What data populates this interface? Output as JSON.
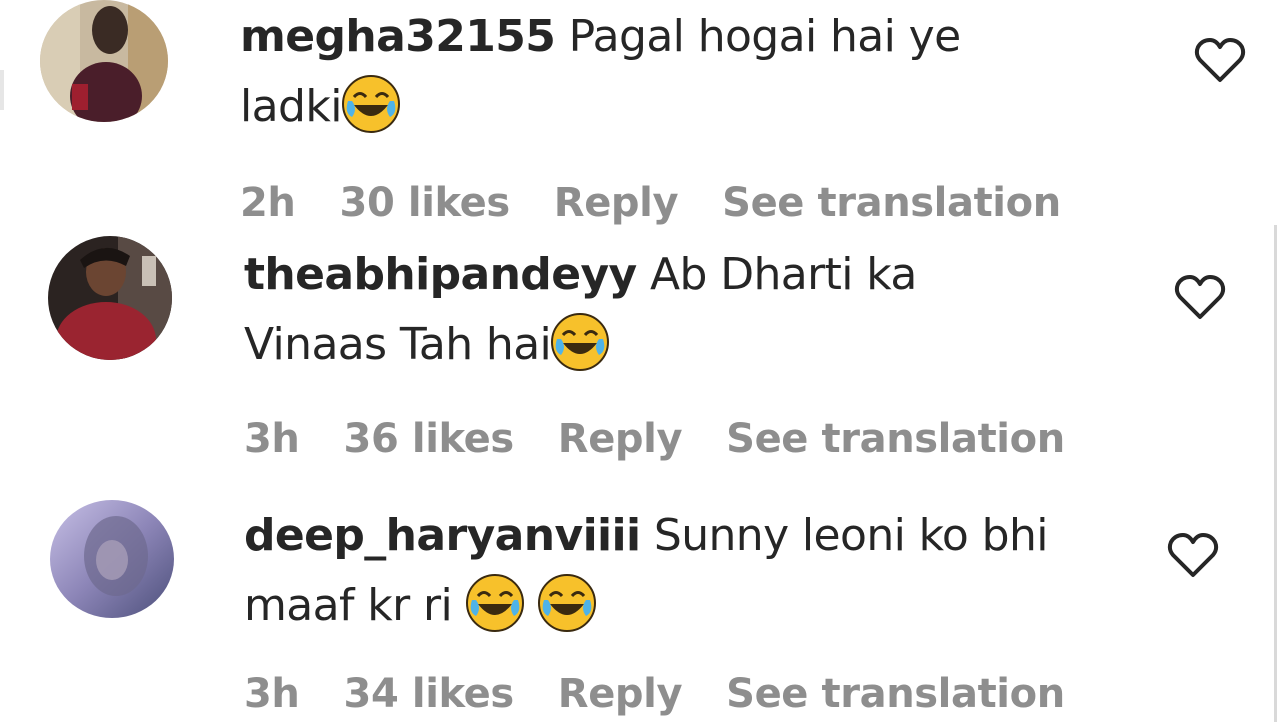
{
  "comments": [
    {
      "username": "megha32155",
      "text_line1": "Pagal hogai hai ye",
      "text_line2": "ladki",
      "emoji": "face-with-tears-of-joy",
      "time": "2h",
      "likes": "30 likes",
      "reply": "Reply",
      "translate": "See translation"
    },
    {
      "username": "theabhipandeyy",
      "text_line1": "Ab Dharti ka",
      "text_line2": "Vinaas Tah hai",
      "emoji": "face-with-tears-of-joy",
      "time": "3h",
      "likes": "36 likes",
      "reply": "Reply",
      "translate": "See translation"
    },
    {
      "username": "deep_haryanviiii",
      "text_line1": "Sunny leoni ko bhi",
      "text_line2": "maaf kr ri",
      "emoji": "face-with-tears-of-joy",
      "time": "3h",
      "likes": "34 likes",
      "reply": "Reply",
      "translate": "See translation"
    }
  ],
  "colors": {
    "text": "#262626",
    "meta": "#8e8e8e",
    "emoji": "#f7c12b"
  },
  "icons": {
    "like": "heart-outline-icon",
    "emoji": "face-with-tears-of-joy-icon"
  }
}
